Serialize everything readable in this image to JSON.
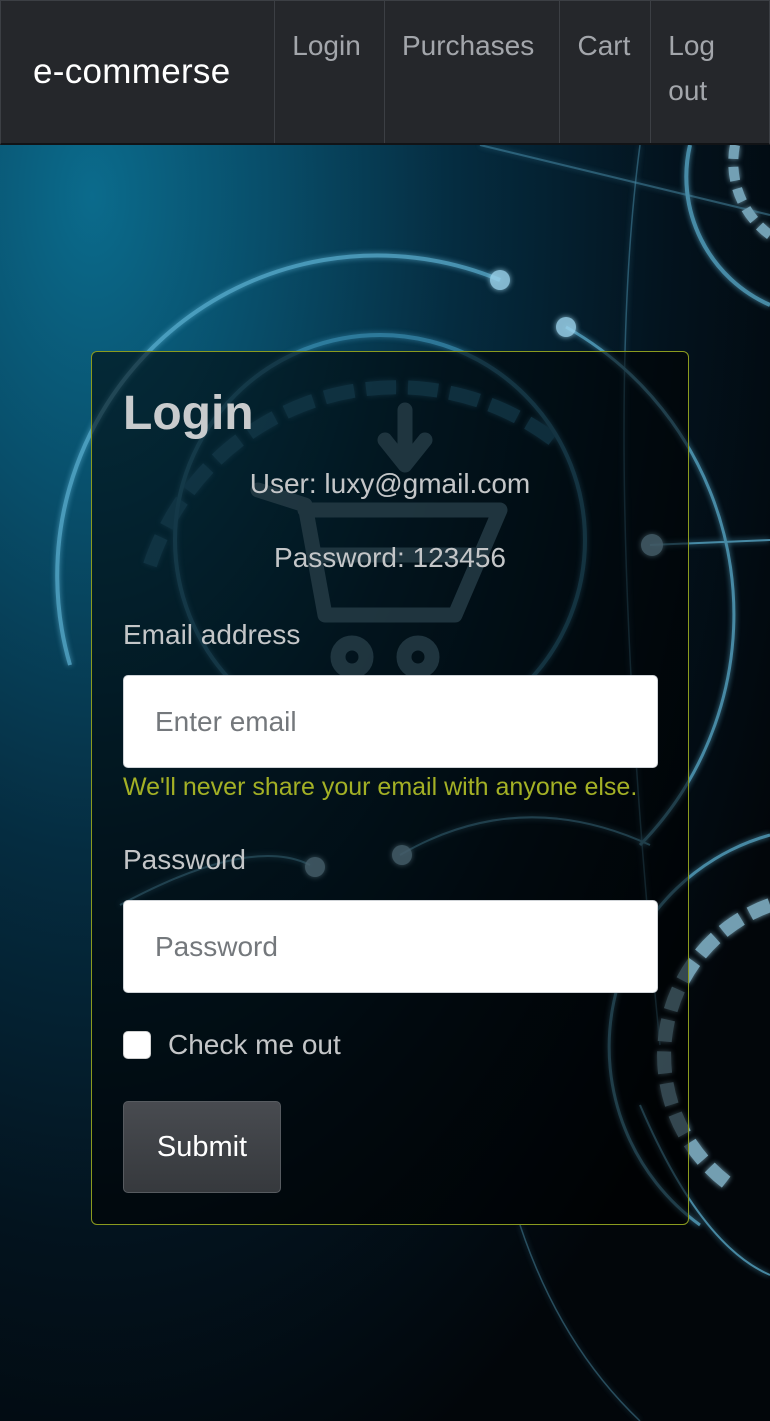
{
  "navbar": {
    "brand": "e-commerse",
    "items": [
      {
        "label": "Login"
      },
      {
        "label": "Purchases"
      },
      {
        "label": "Cart"
      },
      {
        "label": "Log out"
      }
    ]
  },
  "login_card": {
    "title": "Login",
    "demo_user": "User: luxy@gmail.com",
    "demo_password": "Password: 123456",
    "email_label": "Email address",
    "email_placeholder": "Enter email",
    "email_value": "",
    "email_help": "We'll never share your email with anyone else.",
    "password_label": "Password",
    "password_placeholder": "Password",
    "password_value": "",
    "checkbox_label": "Check me out",
    "checkbox_checked": false,
    "submit_label": "Submit"
  },
  "colors": {
    "navbar_bg": "#25272b",
    "nav_text": "#a3a6ab",
    "card_border": "#8a9a1e",
    "help_text": "#a3b025",
    "button_bg": "#3f4246",
    "hero_glow": "#0b6b8c"
  },
  "background": {
    "icon": "shopping-cart-download-icon",
    "style": "glowing blue circuit rings"
  }
}
